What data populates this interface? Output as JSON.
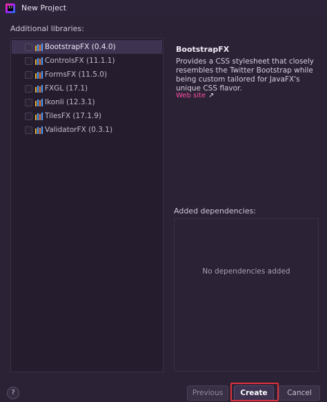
{
  "window": {
    "title": "New Project"
  },
  "libraries": {
    "label": "Additional libraries:",
    "items": [
      {
        "name": "BootstrapFX (0.4.0)",
        "selected": true
      },
      {
        "name": "ControlsFX (11.1.1)",
        "selected": false
      },
      {
        "name": "FormsFX (11.5.0)",
        "selected": false
      },
      {
        "name": "FXGL (17.1)",
        "selected": false
      },
      {
        "name": "Ikonli (12.3.1)",
        "selected": false
      },
      {
        "name": "TilesFX (17.1.9)",
        "selected": false
      },
      {
        "name": "ValidatorFX (0.3.1)",
        "selected": false
      }
    ]
  },
  "details": {
    "title": "BootstrapFX",
    "description": "Provides a CSS stylesheet that closely resembles the Twitter Bootstrap while being custom tailored for JavaFX's unique CSS flavor.",
    "link_label": "Web site",
    "link_icon": "external-link-arrow-icon"
  },
  "dependencies": {
    "label": "Added dependencies:",
    "empty_text": "No dependencies added"
  },
  "footer": {
    "help_label": "?",
    "previous_label": "Previous",
    "create_label": "Create",
    "cancel_label": "Cancel"
  },
  "colors": {
    "background": "#2b2236",
    "link": "#ff4fa3",
    "highlight": "#e0303a"
  }
}
